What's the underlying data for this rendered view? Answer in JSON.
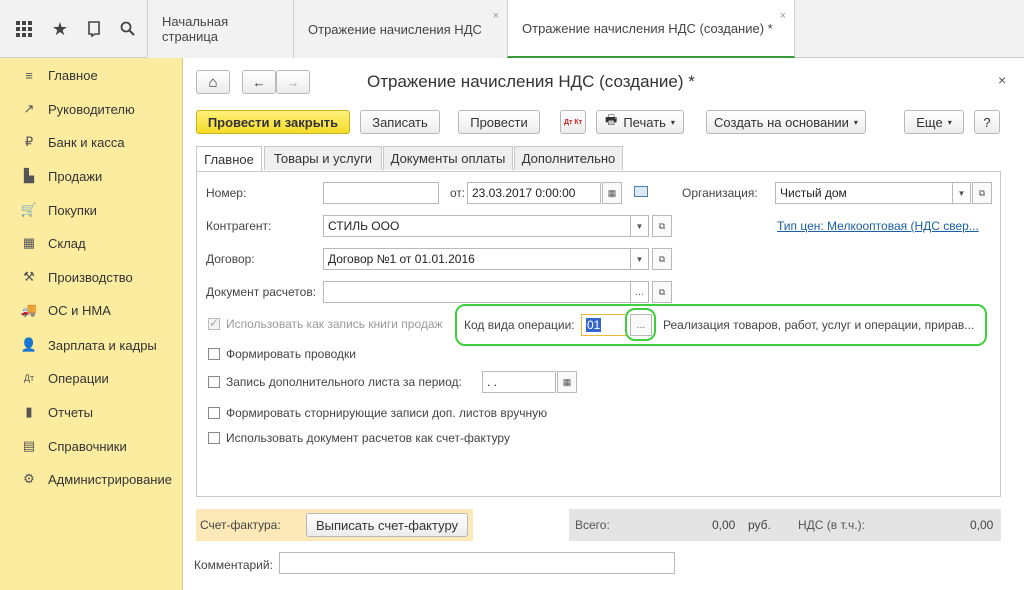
{
  "topbar": {
    "icons": [
      "grid-icon",
      "star-icon",
      "history-icon",
      "search-icon"
    ],
    "tabs": [
      {
        "label": "Начальная страница"
      },
      {
        "label": "Отражение начисления НДС",
        "close": "×"
      },
      {
        "label": "Отражение начисления НДС (создание) *",
        "close": "×"
      }
    ]
  },
  "sidebar": {
    "items": [
      {
        "label": "Главное",
        "icon": "≡"
      },
      {
        "label": "Руководителю",
        "icon": "↗"
      },
      {
        "label": "Банк и касса",
        "icon": "₽"
      },
      {
        "label": "Продажи",
        "icon": "▙"
      },
      {
        "label": "Покупки",
        "icon": "🛒"
      },
      {
        "label": "Склад",
        "icon": "▦"
      },
      {
        "label": "Производство",
        "icon": "⚒"
      },
      {
        "label": "ОС и НМА",
        "icon": "🚚"
      },
      {
        "label": "Зарплата и кадры",
        "icon": "👤"
      },
      {
        "label": "Операции",
        "icon": "Дт"
      },
      {
        "label": "Отчеты",
        "icon": "▮"
      },
      {
        "label": "Справочники",
        "icon": "▤"
      },
      {
        "label": "Администрирование",
        "icon": "⚙"
      }
    ]
  },
  "doc": {
    "title": "Отражение начисления НДС (создание) *",
    "close": "×",
    "nav_home": "⌂",
    "nav_back": "←",
    "nav_fwd": "→"
  },
  "toolbar": {
    "post_close": "Провести и закрыть",
    "save": "Записать",
    "post": "Провести",
    "dtkt": "Дт Кт",
    "print": "Печать",
    "create_based": "Создать на основании",
    "more": "Еще",
    "help": "?"
  },
  "formtabs": [
    "Главное",
    "Товары и услуги",
    "Документы оплаты",
    "Дополнительно"
  ],
  "form": {
    "number_label": "Номер:",
    "number_value": "",
    "from_label": "от:",
    "date_value": "23.03.2017  0:00:00",
    "org_label": "Организация:",
    "org_value": "Чистый дом",
    "contractor_label": "Контрагент:",
    "contractor_value": "СТИЛЬ ООО",
    "price_type_link": "Тип цен: Мелкооптовая (НДС свер...",
    "contract_label": "Договор:",
    "contract_value": "Договор №1 от 01.01.2016",
    "settlement_label": "Документ расчетов:",
    "settlement_value": "",
    "use_as_book_label": "Использовать как запись книги продаж",
    "op_code_label": "Код вида операции:",
    "op_code_value": "01",
    "op_code_desc": "Реализация товаров, работ, услуг и операции, прирав...",
    "form_postings_label": "Формировать проводки",
    "extra_sheet_label": "Запись дополнительного листа за период:",
    "extra_sheet_value": " .  .",
    "storno_label": "Формировать сторнирующие записи доп. листов вручную",
    "use_settlement_label": "Использовать документ расчетов как счет-фактуру"
  },
  "footer": {
    "invoice_label": "Счет-фактура:",
    "invoice_button": "Выписать счет-фактуру",
    "total_label": "Всего:",
    "total_value": "0,00",
    "currency": "руб.",
    "vat_label": "НДС (в т.ч.):",
    "vat_value": "0,00",
    "comment_label": "Комментарий:",
    "comment_value": ""
  }
}
